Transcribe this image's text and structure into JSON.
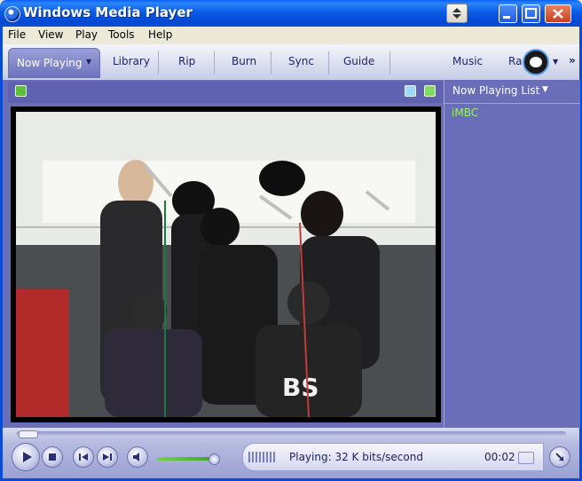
{
  "window": {
    "title": "Windows Media Player",
    "icons": {
      "app": "media-player-icon",
      "compact": "compact-mode-icon",
      "minimize": "minimize-icon",
      "maximize": "maximize-icon",
      "close": "close-icon"
    }
  },
  "menu": {
    "items": [
      "File",
      "View",
      "Play",
      "Tools",
      "Help"
    ]
  },
  "taskbar": {
    "tabs": [
      {
        "label": "Now Playing",
        "active": true
      },
      {
        "label": "Library"
      },
      {
        "label": "Rip"
      },
      {
        "label": "Burn"
      },
      {
        "label": "Sync"
      },
      {
        "label": "Guide"
      },
      {
        "label": "Music"
      },
      {
        "label": "Ra"
      }
    ],
    "more": "»"
  },
  "playlist": {
    "title": "Now Playing List",
    "items": [
      "iMBC"
    ]
  },
  "player": {
    "status": "Playing: 32 K bits/second",
    "time": "00:02",
    "volume": 0.85,
    "seek_position": 0.0
  },
  "colors": {
    "accent": "#0a4cd8",
    "panel": "#6a6eb8",
    "playlist_item": "#9bf36a"
  }
}
